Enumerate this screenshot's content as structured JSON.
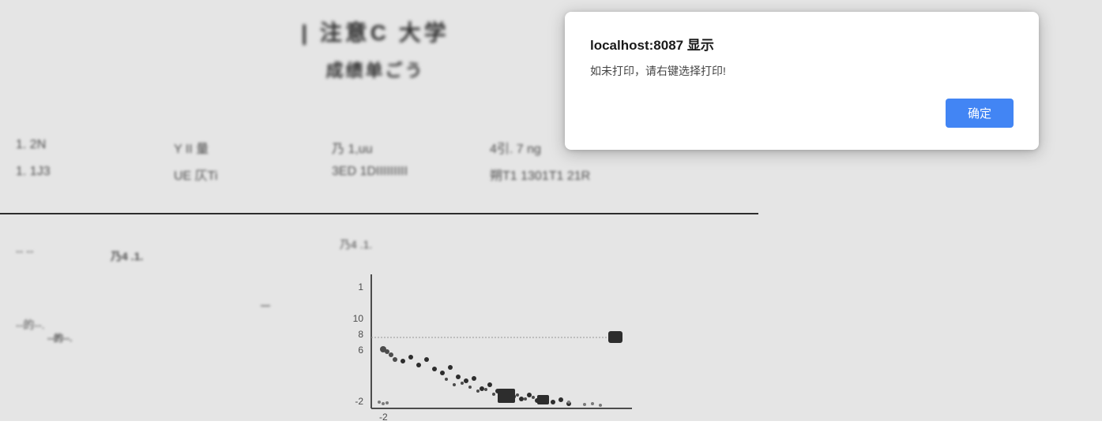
{
  "dialog": {
    "title": "localhost:8087 显示",
    "message": "如未打印，请右键选择打印!",
    "confirm_label": "确定"
  },
  "page": {
    "header_title": "| 注意C 大学",
    "header_subtitle": "成绩单ごう",
    "data_rows": [
      {
        "cells": [
          "1. 2N",
          "Y II 量",
          "乃 1,uu",
          "4引. 7 ng"
        ]
      },
      {
        "cells": [
          "1. 1J3",
          "UE 仄Ti",
          "3ED 1DIIIIIIIII",
          "朔T1 1301T1 21R"
        ]
      }
    ],
    "chart_label": "乃4 .1.",
    "left_label": "-- --",
    "left_sublabel": "--的--."
  },
  "chart": {
    "y_axis_labels": [
      "1",
      "10",
      "8",
      "6",
      "-2"
    ],
    "x_axis_label": "-2"
  }
}
